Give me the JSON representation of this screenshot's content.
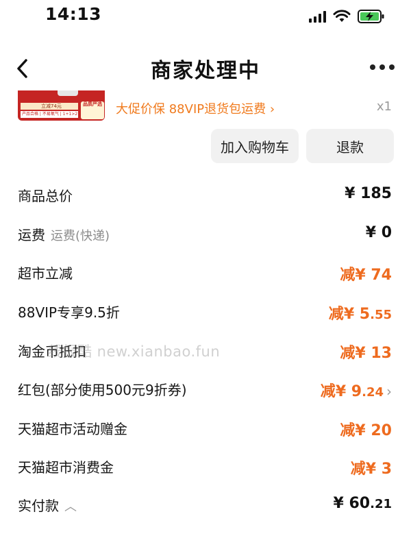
{
  "status_bar": {
    "time": "14:13"
  },
  "nav": {
    "title": "商家处理中"
  },
  "product": {
    "thumb_price": "立减74元",
    "thumb_tags": "产品合格 | 不易氧气 | 1+1>2",
    "thumb_badge": "品质严选",
    "promo": "大促价保  88VIP退货包运费 ›",
    "qty": "x1"
  },
  "actions": {
    "add_to_cart": "加入购物车",
    "refund": "退款"
  },
  "rows": [
    {
      "label": "商品总价",
      "sub": "",
      "prefix": "",
      "currency": "¥",
      "int": "185",
      "dec": ""
    },
    {
      "label": "运费",
      "sub": "运费(快递)",
      "prefix": "",
      "currency": "¥",
      "int": "0",
      "dec": ""
    },
    {
      "label": "超市立减",
      "sub": "",
      "prefix": "减",
      "currency": "¥",
      "int": "74",
      "dec": ""
    },
    {
      "label": "88VIP专享9.5折",
      "sub": "",
      "prefix": "减",
      "currency": "¥",
      "int": "5",
      "dec": ".55"
    },
    {
      "label": "淘金币抵扣",
      "sub": "",
      "prefix": "减",
      "currency": "¥",
      "int": "13",
      "dec": ""
    },
    {
      "label": "红包(部分使用500元9折券)",
      "sub": "",
      "prefix": "减",
      "currency": "¥",
      "int": "9",
      "dec": ".24",
      "chevron": "›"
    },
    {
      "label": "天猫超市活动赠金",
      "sub": "",
      "prefix": "减",
      "currency": "¥",
      "int": "20",
      "dec": ""
    },
    {
      "label": "天猫超市消费金",
      "sub": "",
      "prefix": "减",
      "currency": "¥",
      "int": "3",
      "dec": ""
    }
  ],
  "total": {
    "label": "实付款",
    "caret": "︿",
    "currency": "¥",
    "int": "60",
    "dec": ".21"
  },
  "watermark": "线报酷 new.xianbao.fun",
  "colors": {
    "accent": "#ee6b1f",
    "promo": "#f07a1d",
    "button_bg": "#f1f1f1"
  },
  "icons": {
    "back": "chevron-left-icon",
    "more": "more-dots-icon",
    "signal": "cellular-signal-icon",
    "wifi": "wifi-icon",
    "battery": "battery-charging-icon"
  }
}
